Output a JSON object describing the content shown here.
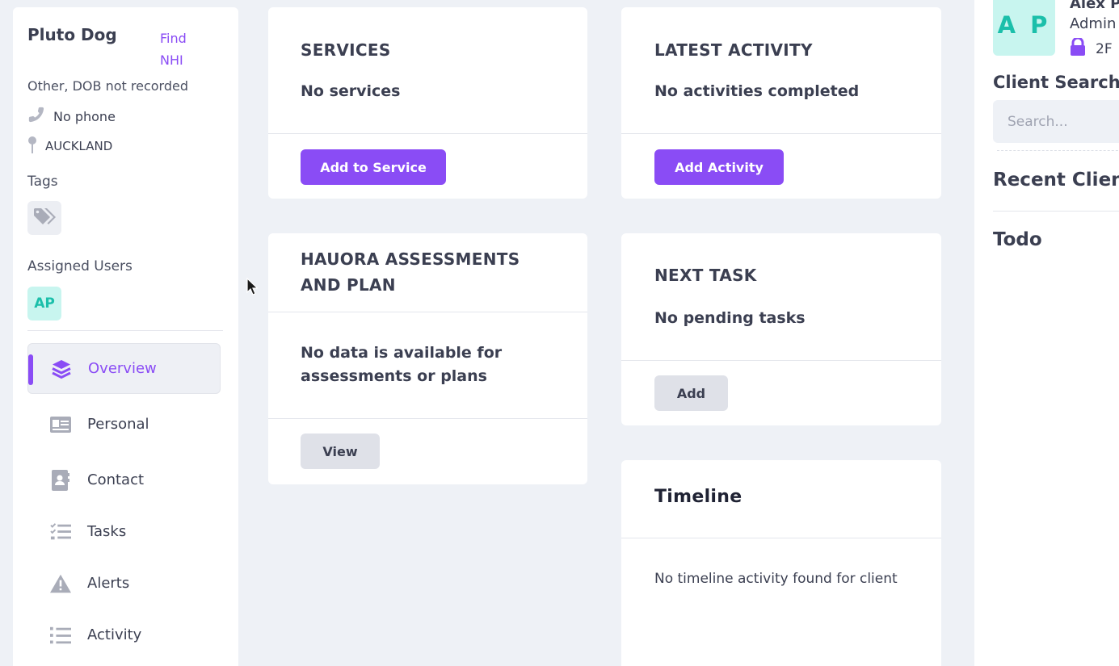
{
  "client": {
    "name": "Pluto Dog",
    "find_nhi": "Find NHI",
    "dob": "Other, DOB not recorded",
    "phone": "No phone",
    "location": "AUCKLAND",
    "tags_label": "Tags",
    "assigned_label": "Assigned Users",
    "assigned_initials": "AP"
  },
  "nav": {
    "items": [
      {
        "label": "Overview",
        "icon": "layers-icon",
        "active": true
      },
      {
        "label": "Personal",
        "icon": "id-card-icon"
      },
      {
        "label": "Contact",
        "icon": "address-book-icon"
      },
      {
        "label": "Tasks",
        "icon": "tasks-icon"
      },
      {
        "label": "Alerts",
        "icon": "warning-icon"
      },
      {
        "label": "Activity",
        "icon": "list-icon"
      }
    ]
  },
  "cards": {
    "services": {
      "title": "SERVICES",
      "body": "No services",
      "button": "Add to Service"
    },
    "latest_activity": {
      "title": "LATEST ACTIVITY",
      "body": "No activities completed",
      "button": "Add Activity"
    },
    "hauora": {
      "title_line1": "HAUORA ASSESSMENTS",
      "title_line2": "AND PLAN",
      "body_line1": "No data is available for",
      "body_line2": "assessments or plans",
      "button": "View"
    },
    "next_task": {
      "title": "NEXT TASK",
      "body": "No pending tasks",
      "button": "Add"
    },
    "timeline": {
      "title": "Timeline",
      "body": "No timeline activity found for client"
    }
  },
  "user": {
    "initials": "A P",
    "name": "Alex Po",
    "role": "Admin",
    "twofa": "2F"
  },
  "right_panel": {
    "client_search_label": "Client Search",
    "search_placeholder": "Search...",
    "recent_clients": "Recent Clien",
    "todo": "Todo"
  },
  "colors": {
    "accent": "#8a4cf5",
    "avatar_bg": "#c8f5ef",
    "avatar_fg": "#1bbfaa",
    "page_bg": "#eef1f6"
  }
}
